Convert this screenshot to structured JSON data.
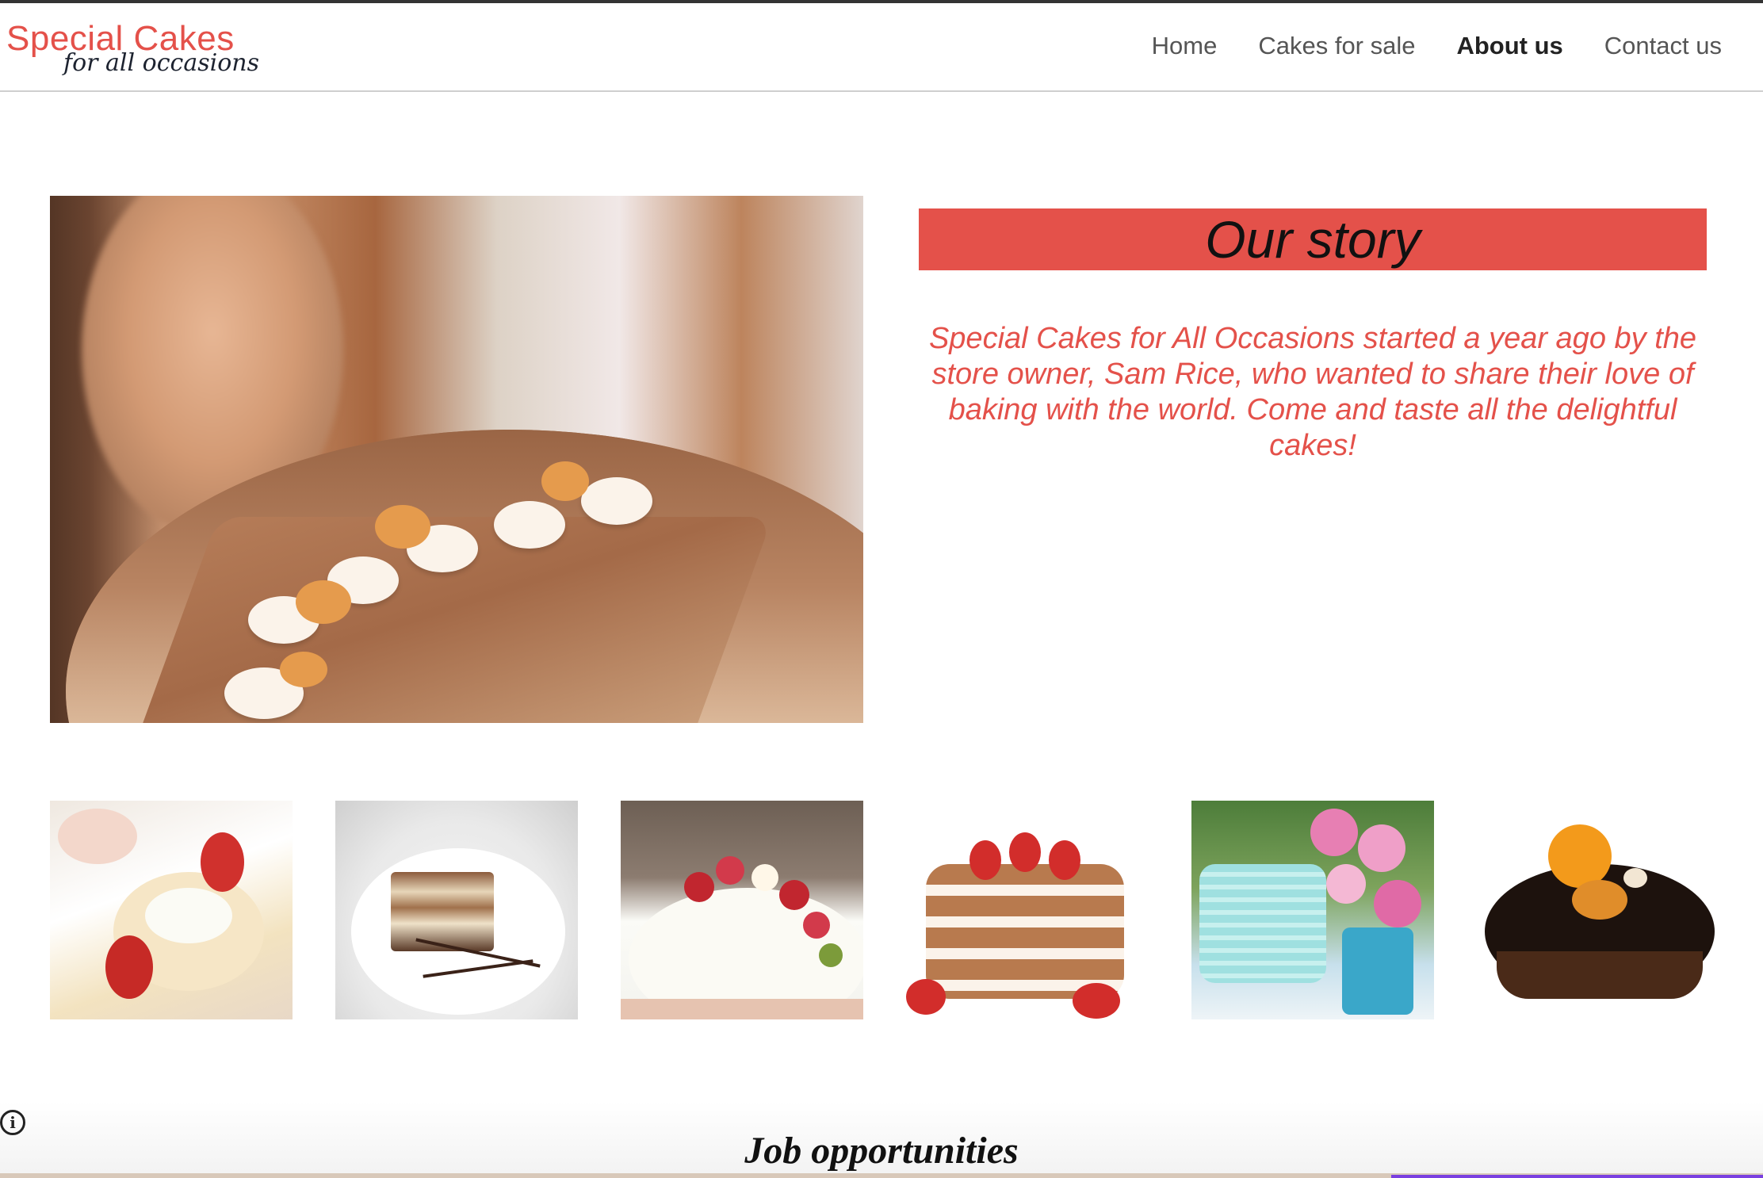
{
  "brand": {
    "name": "Special Cakes",
    "tagline": "for all occasions",
    "accent_color": "#e4514a"
  },
  "nav": {
    "items": [
      {
        "label": "Home",
        "active": false
      },
      {
        "label": "Cakes for sale",
        "active": false
      },
      {
        "label": "About us",
        "active": true
      },
      {
        "label": "Contact us",
        "active": false
      }
    ]
  },
  "story": {
    "title": "Our story",
    "text": "Special Cakes for All Occasions started a year ago by the store owner, Sam Rice, who wanted to share their love of baking with the world. Come and taste all the delightful cakes!"
  },
  "gallery": {
    "items": [
      {
        "name": "strawberry-shortcake-photo"
      },
      {
        "name": "tiramisu-slice-photo"
      },
      {
        "name": "flower-decorated-cake-photo"
      },
      {
        "name": "strawberry-layer-cake-photo"
      },
      {
        "name": "blue-ruffle-cake-photo"
      },
      {
        "name": "chocolate-orange-cake-photo"
      }
    ]
  },
  "jobs": {
    "title": "Job opportunities"
  },
  "icons": {
    "info": "info-icon"
  }
}
